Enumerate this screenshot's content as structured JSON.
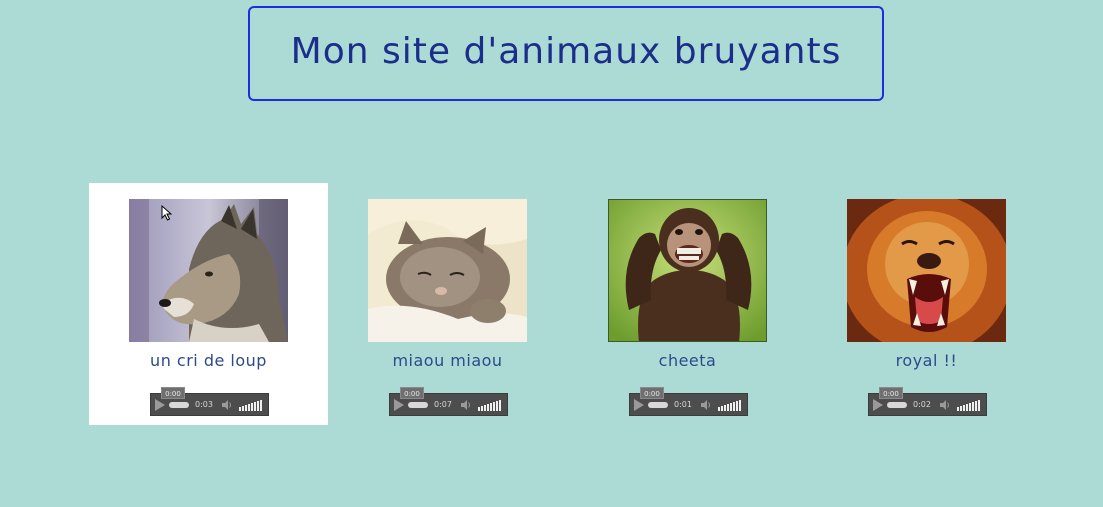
{
  "header": {
    "title": "Mon site d'animaux bruyants"
  },
  "animals": [
    {
      "caption": "un cri de loup",
      "photo_icon": "wolf-photo",
      "player": {
        "current_time": "0:00",
        "duration": "0:03"
      },
      "selected": true
    },
    {
      "caption": "miaou miaou",
      "photo_icon": "kitten-photo",
      "player": {
        "current_time": "0:00",
        "duration": "0:07"
      },
      "selected": false
    },
    {
      "caption": "cheeta",
      "photo_icon": "chimpanzee-photo",
      "player": {
        "current_time": "0:00",
        "duration": "0:01"
      },
      "selected": false
    },
    {
      "caption": "royal !!",
      "photo_icon": "lion-photo",
      "player": {
        "current_time": "0:00",
        "duration": "0:02"
      },
      "selected": false
    }
  ],
  "colors": {
    "background": "#acdbd6",
    "title_border": "#1f2de0",
    "title_text": "#1b2f8a",
    "caption_text": "#2c4a8c",
    "player_bg": "#4d4d4d"
  }
}
